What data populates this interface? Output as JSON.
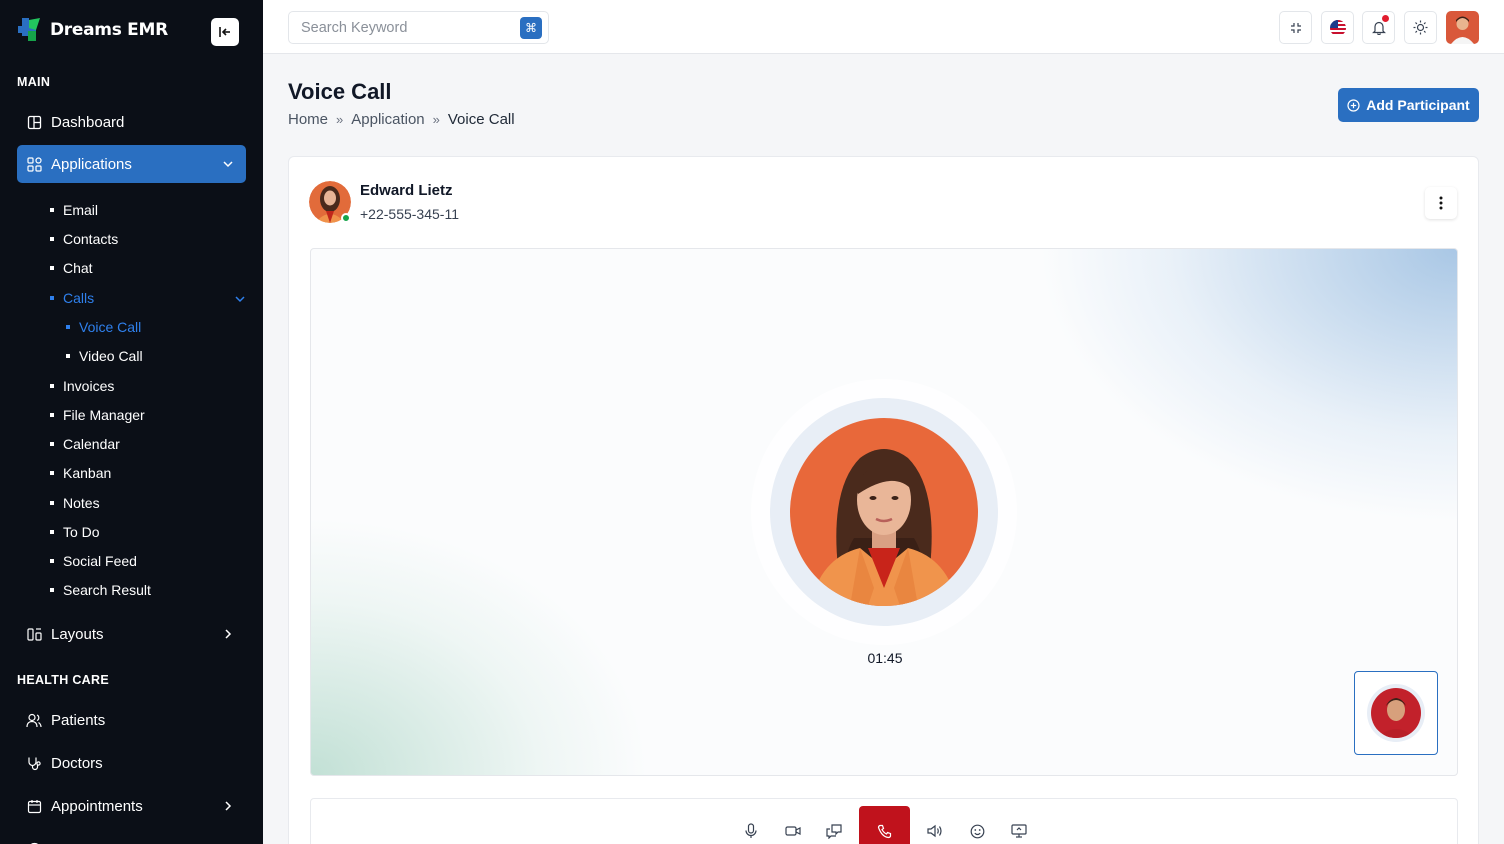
{
  "app": {
    "brand": "Dreams EMR",
    "accent": "#2a6fc1"
  },
  "sidebar": {
    "section_main": "MAIN",
    "section_health": "HEALTH CARE",
    "dashboard": "Dashboard",
    "applications": "Applications",
    "sub_items": {
      "email": "Email",
      "contacts": "Contacts",
      "chat": "Chat",
      "calls": "Calls",
      "voice_call": "Voice Call",
      "video_call": "Video Call",
      "invoices": "Invoices",
      "file_manager": "File Manager",
      "calendar": "Calendar",
      "kanban": "Kanban",
      "notes": "Notes",
      "todo": "To Do",
      "social_feed": "Social Feed",
      "search_result": "Search Result"
    },
    "layouts": "Layouts",
    "patients": "Patients",
    "doctors": "Doctors",
    "appointments": "Appointments"
  },
  "topbar": {
    "search_placeholder": "Search Keyword",
    "search_shortcut": "⌘"
  },
  "page": {
    "title": "Voice Call",
    "breadcrumb": [
      "Home",
      "Application",
      "Voice Call"
    ],
    "add_participant": "Add Participant"
  },
  "call": {
    "caller_name": "Edward Lietz",
    "caller_phone": "+22-555-345-11",
    "timer": "01:45",
    "end_call_color": "#c0121c"
  },
  "icons": {
    "controls": [
      "microphone-icon",
      "video-camera-icon",
      "chat-icon",
      "end-call-icon",
      "speaker-icon",
      "emoji-icon",
      "screen-share-icon"
    ]
  }
}
